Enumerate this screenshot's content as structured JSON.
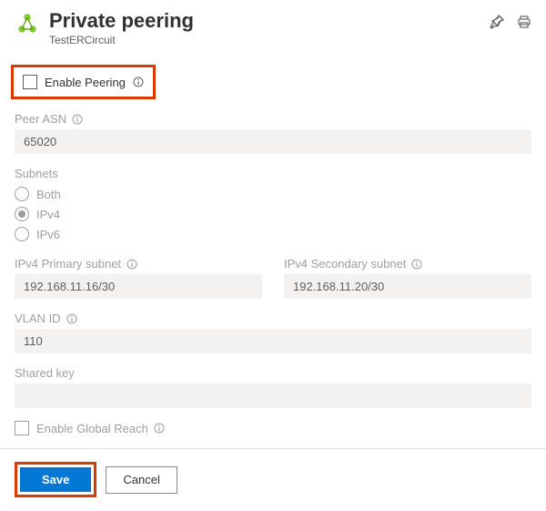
{
  "header": {
    "title": "Private peering",
    "subtitle": "TestERCircuit"
  },
  "enable_peering": {
    "label": "Enable Peering",
    "checked": false
  },
  "peer_asn": {
    "label": "Peer ASN",
    "value": "65020"
  },
  "subnets": {
    "label": "Subnets",
    "options": [
      "Both",
      "IPv4",
      "IPv6"
    ],
    "selected": "IPv4"
  },
  "ipv4_primary": {
    "label": "IPv4 Primary subnet",
    "value": "192.168.11.16/30"
  },
  "ipv4_secondary": {
    "label": "IPv4 Secondary subnet",
    "value": "192.168.11.20/30"
  },
  "vlan_id": {
    "label": "VLAN ID",
    "value": "110"
  },
  "shared_key": {
    "label": "Shared key",
    "value": ""
  },
  "global_reach": {
    "label": "Enable Global Reach",
    "checked": false
  },
  "footer": {
    "save": "Save",
    "cancel": "Cancel"
  }
}
